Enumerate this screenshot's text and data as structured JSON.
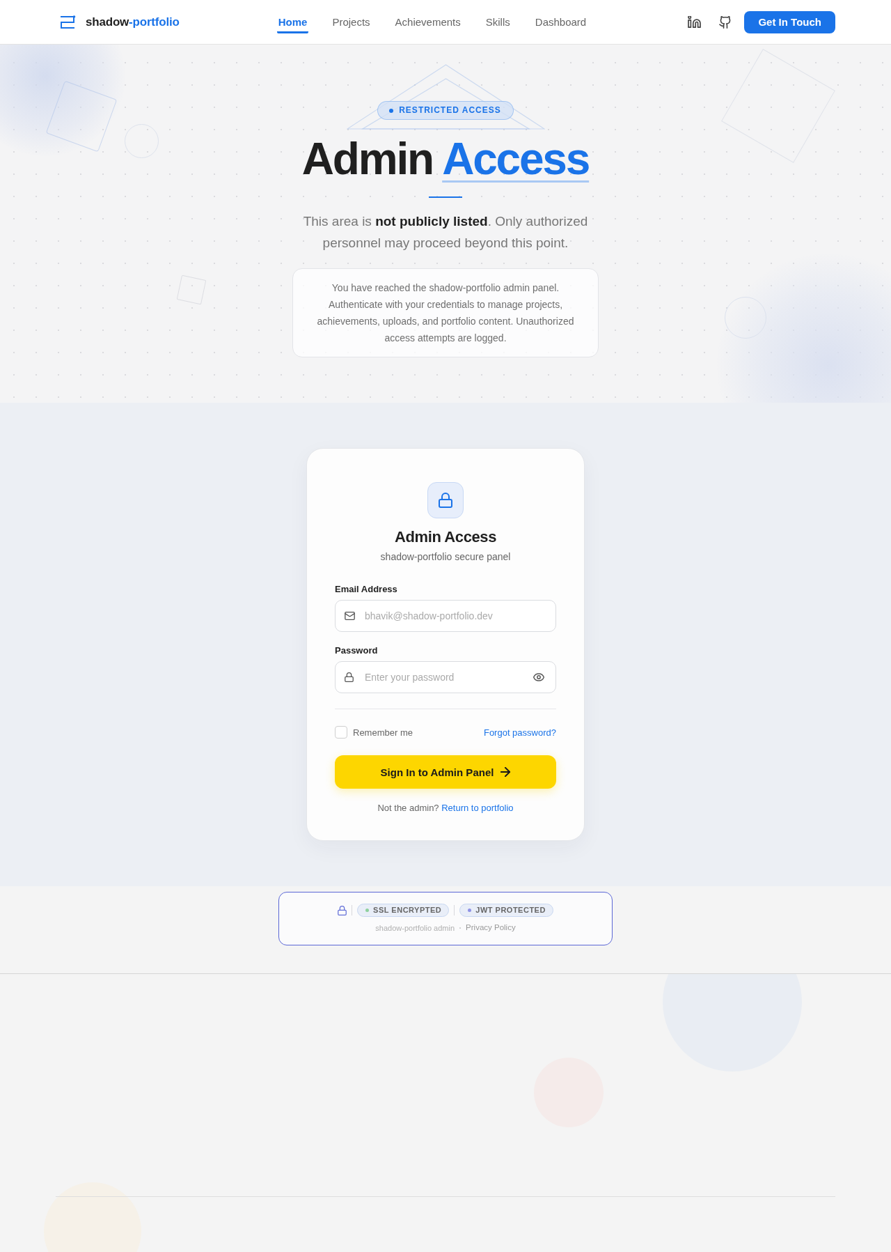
{
  "header": {
    "logo": {
      "text": "shadow",
      "accent": "-portfolio"
    },
    "nav": [
      {
        "label": "Home",
        "selected": true
      },
      {
        "label": "Projects",
        "selected": false
      },
      {
        "label": "Achievements",
        "selected": false
      },
      {
        "label": "Skills",
        "selected": false
      },
      {
        "label": "Dashboard",
        "selected": false
      }
    ],
    "cta": "Get In Touch"
  },
  "hero": {
    "badge": "RESTRICTED ACCESS",
    "title": "Admin",
    "title_accent": "Access",
    "subtitle": "This area is **not publicly listed**. Only authorized personnel may proceed beyond this point.",
    "notice": "You have reached the shadow-portfolio admin panel. Authenticate with your credentials to manage projects, achievements, uploads, and portfolio content. Unauthorized access attempts are logged."
  },
  "login": {
    "title": "Admin Access",
    "subtitle": "shadow-portfolio secure panel",
    "fields": [
      {
        "kind": "email",
        "label": "Email Address",
        "placeholder": "bhavik@shadow-portfolio.dev"
      },
      {
        "kind": "password",
        "label": "Password",
        "placeholder": "Enter your password"
      }
    ],
    "remember": {
      "label": "Remember me",
      "checked": false
    },
    "forgot_link": "Forgot password?",
    "submit": "Sign In to Admin Panel",
    "footer_text": "Not the admin?",
    "footer_link": "Return to portfolio"
  },
  "security": {
    "badges": [
      {
        "label": "SSL ENCRYPTED",
        "color": "#8fd19e"
      },
      {
        "label": "JWT PROTECTED",
        "color": "#8f92e6"
      }
    ],
    "footer_text": "shadow-portfolio admin",
    "footer_link": "Privacy Policy"
  }
}
